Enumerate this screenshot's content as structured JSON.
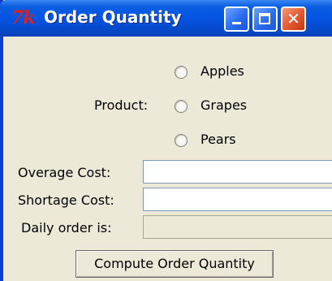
{
  "window": {
    "app_icon_text": "7k",
    "title": "Order Quantity",
    "close_symbol": "✕"
  },
  "product": {
    "label": "Product:",
    "options": [
      "Apples",
      "Grapes",
      "Pears"
    ],
    "selected": null
  },
  "fields": {
    "overage_label": "Overage Cost:",
    "overage_value": "",
    "shortage_label": "Shortage Cost:",
    "shortage_value": "",
    "daily_label": "Daily order is:",
    "daily_value": ""
  },
  "compute_button": "Compute Order Quantity",
  "colors": {
    "titlebar": "#0554e3",
    "window_bg": "#ece9d8",
    "field_border": "#7f9db9"
  }
}
